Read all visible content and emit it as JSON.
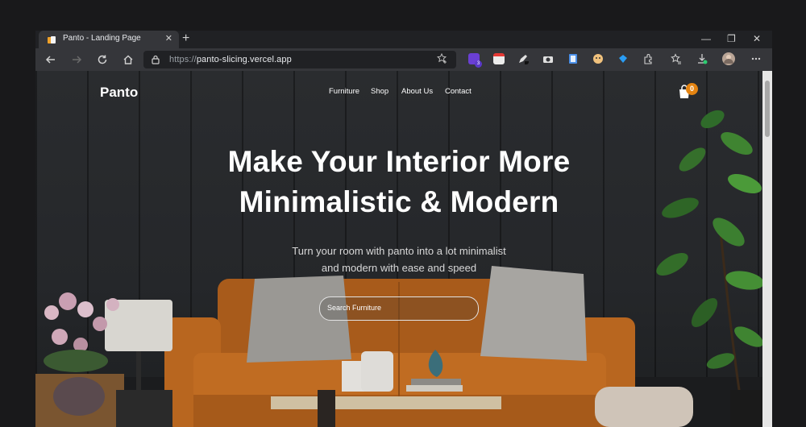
{
  "browser": {
    "tab_title": "Panto - Landing Page",
    "tab_close": "✕",
    "new_tab": "+",
    "url_protocol": "https://",
    "url_host": "panto-slicing.vercel.app",
    "window_controls": [
      "—",
      "❐",
      "✕"
    ],
    "extension_badge_count": "3",
    "icons": [
      "back-icon",
      "forward-icon",
      "reload-icon",
      "home-icon",
      "lock-icon",
      "star-add-icon",
      "extensions-icon",
      "favorites-icon",
      "downloads-icon",
      "profile-avatar",
      "more-icon"
    ]
  },
  "site": {
    "logo": "Panto",
    "nav": [
      "Furniture",
      "Shop",
      "About Us",
      "Contact"
    ],
    "cart_count": "0",
    "headline_line1": "Make Your Interior More",
    "headline_line2": "Minimalistic & Modern",
    "sub_line1": "Turn your room with panto into a lot minimalist",
    "sub_line2": "and modern with ease and speed",
    "search_placeholder": "Search Furniture"
  },
  "colors": {
    "accent": "#e58411",
    "sofa": "#b8661f",
    "wall": "#26282b"
  }
}
